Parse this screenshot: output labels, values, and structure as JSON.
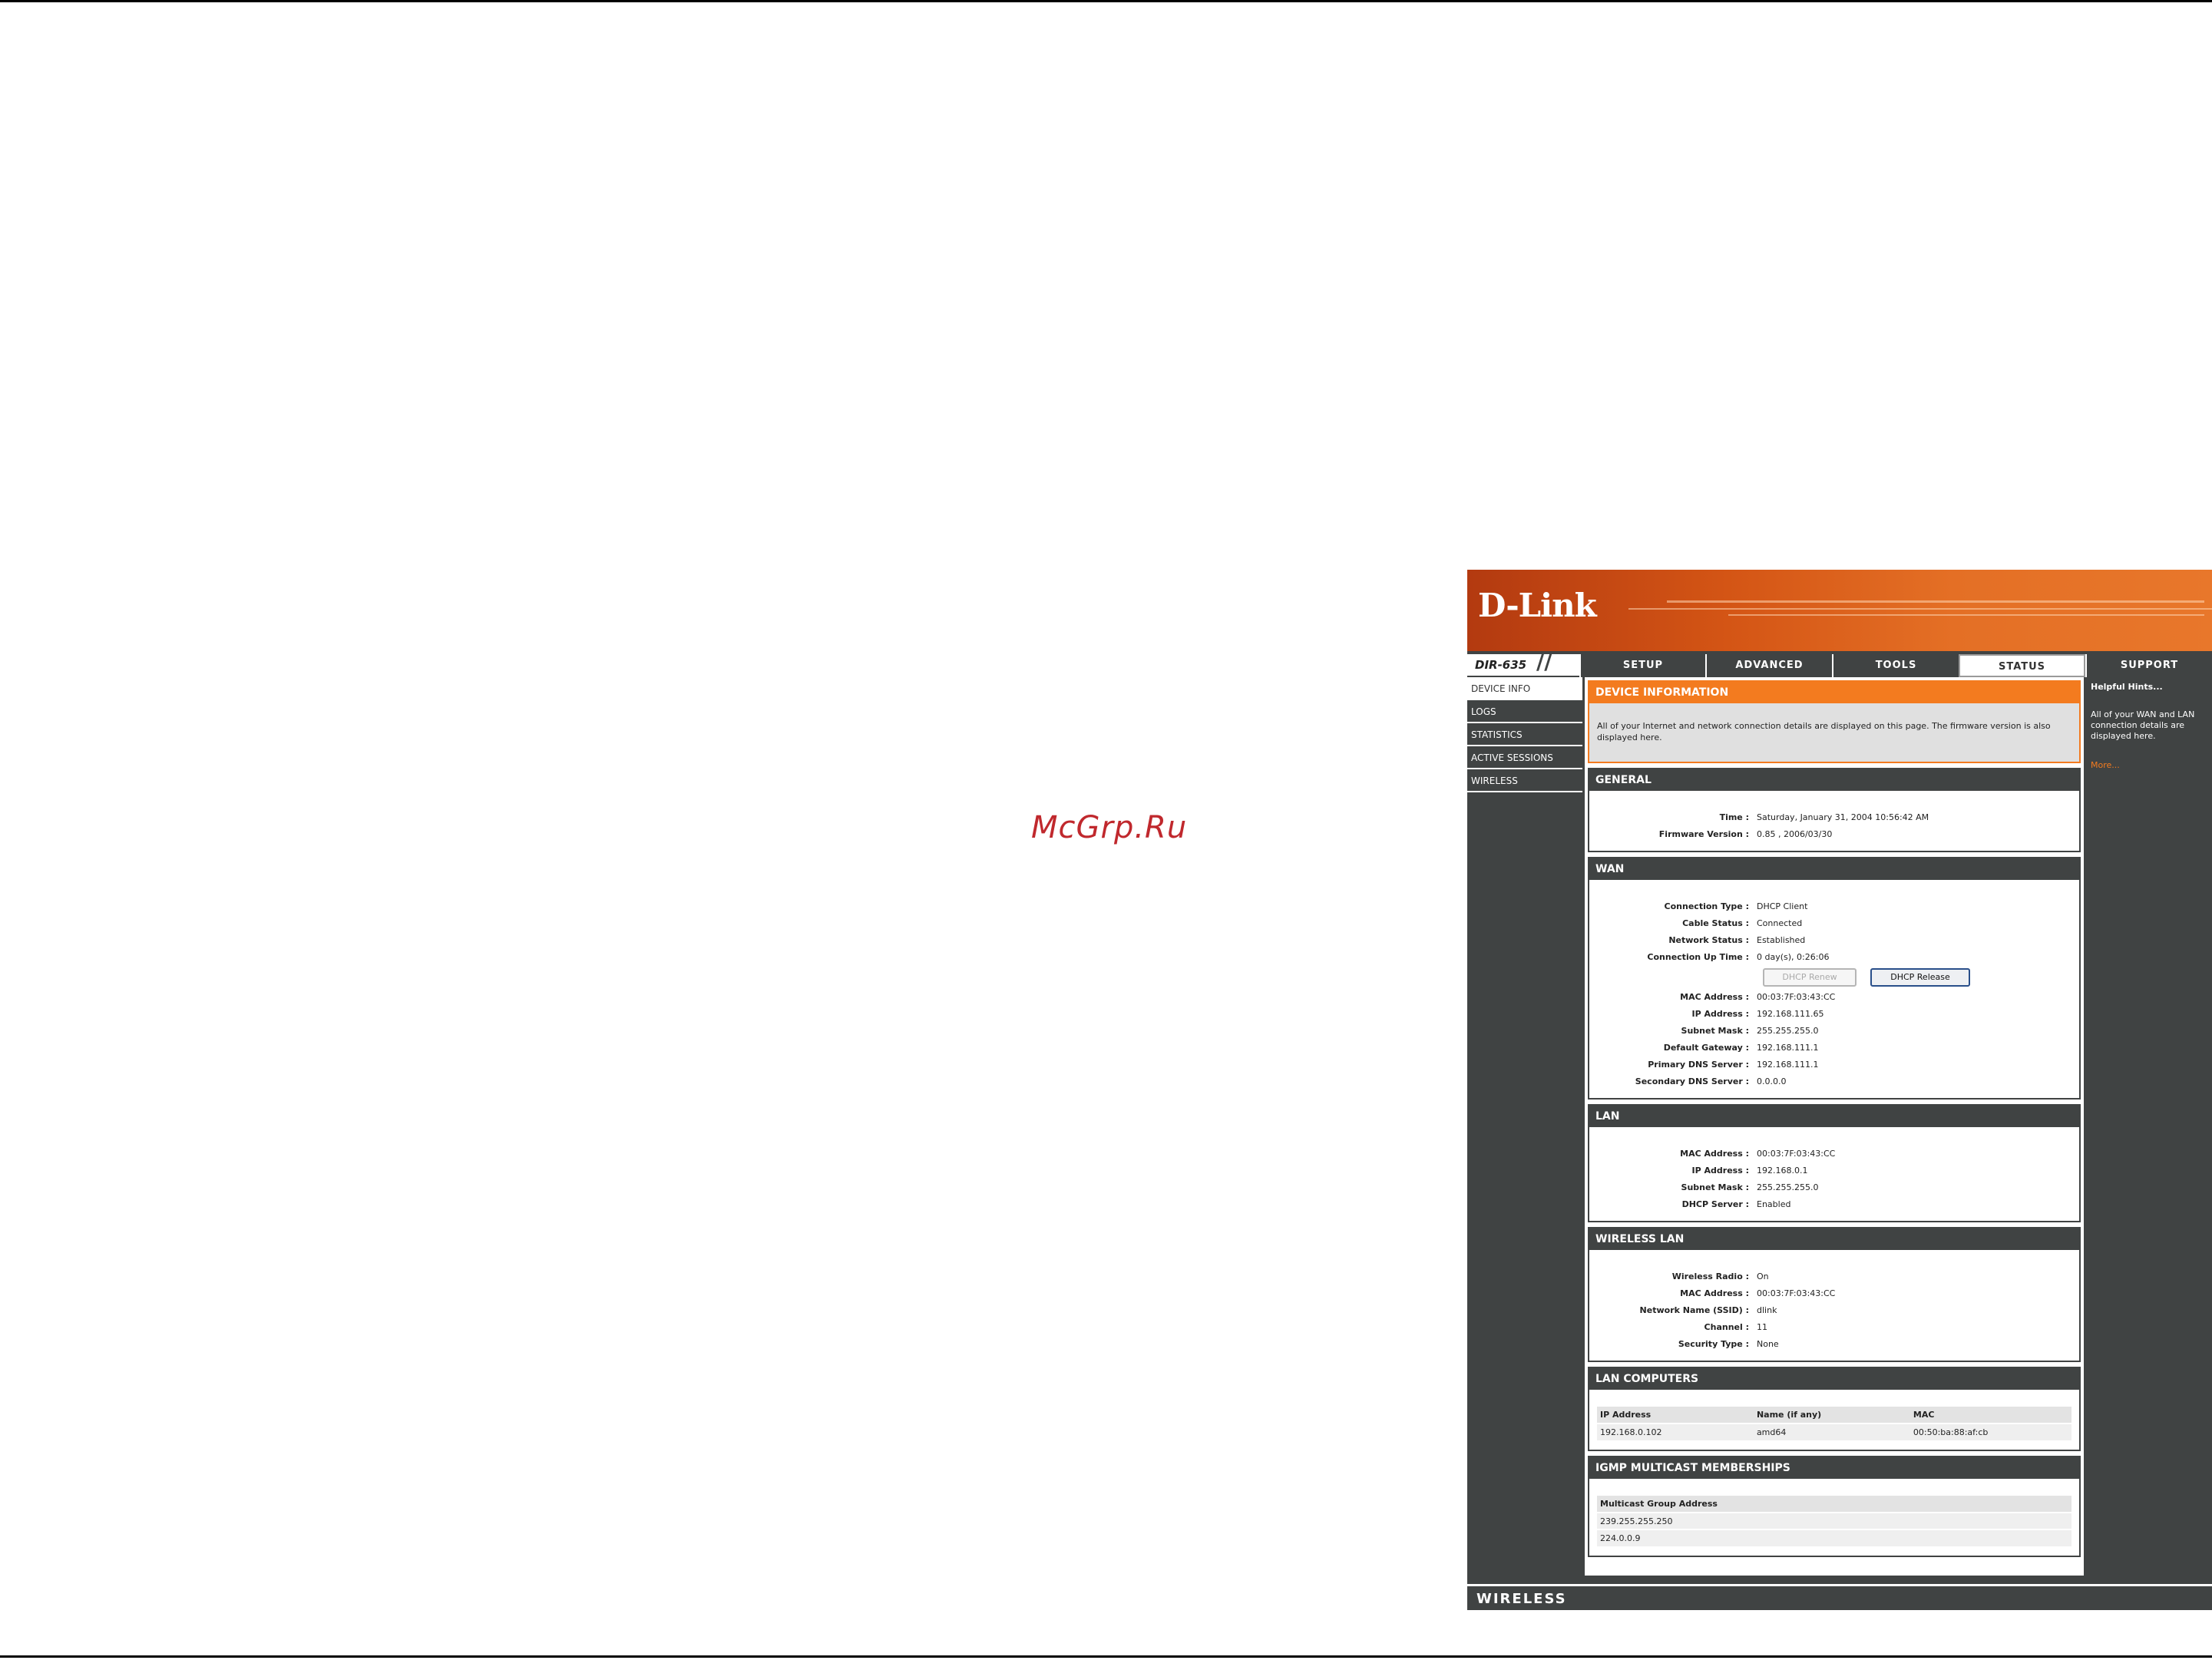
{
  "watermark": "McGrp.Ru",
  "brand": {
    "logo": "D-Link",
    "model": "DIR-635",
    "footer": "WIRELESS"
  },
  "tabs": [
    {
      "label": "SETUP"
    },
    {
      "label": "ADVANCED"
    },
    {
      "label": "TOOLS"
    },
    {
      "label": "STATUS",
      "active": true
    },
    {
      "label": "SUPPORT"
    }
  ],
  "sidebar": {
    "items": [
      {
        "label": "DEVICE INFO",
        "active": true
      },
      {
        "label": "LOGS"
      },
      {
        "label": "STATISTICS"
      },
      {
        "label": "ACTIVE SESSIONS"
      },
      {
        "label": "WIRELESS"
      }
    ]
  },
  "device_info": {
    "title": "DEVICE INFORMATION",
    "intro": "All of your Internet and network connection details are displayed on this page. The firmware version is also displayed here."
  },
  "general": {
    "title": "GENERAL",
    "time_label": "Time :",
    "time": "Saturday, January 31, 2004 10:56:42 AM",
    "firmware_label": "Firmware Version :",
    "firmware": "0.85 ,    2006/03/30"
  },
  "wan": {
    "title": "WAN",
    "connection_type_label": "Connection Type :",
    "connection_type": "DHCP Client",
    "cable_status_label": "Cable Status :",
    "cable_status": "Connected",
    "network_status_label": "Network Status :",
    "network_status": "Established",
    "uptime_label": "Connection Up Time :",
    "uptime": "0 day(s), 0:26:06",
    "renew_button": "DHCP Renew",
    "release_button": "DHCP Release",
    "mac_label": "MAC Address :",
    "mac": "00:03:7F:03:43:CC",
    "ip_label": "IP Address :",
    "ip": "192.168.111.65",
    "subnet_label": "Subnet Mask :",
    "subnet": "255.255.255.0",
    "gateway_label": "Default Gateway :",
    "gateway": "192.168.111.1",
    "dns1_label": "Primary DNS Server :",
    "dns1": "192.168.111.1",
    "dns2_label": "Secondary DNS Server :",
    "dns2": "0.0.0.0"
  },
  "lan": {
    "title": "LAN",
    "mac_label": "MAC Address :",
    "mac": "00:03:7F:03:43:CC",
    "ip_label": "IP Address :",
    "ip": "192.168.0.1",
    "subnet_label": "Subnet Mask :",
    "subnet": "255.255.255.0",
    "dhcp_label": "DHCP Server :",
    "dhcp": "Enabled"
  },
  "wireless_lan": {
    "title": "WIRELESS LAN",
    "radio_label": "Wireless Radio :",
    "radio": "On",
    "mac_label": "MAC Address :",
    "mac": "00:03:7F:03:43:CC",
    "ssid_label": "Network Name (SSID) :",
    "ssid": "dlink",
    "channel_label": "Channel :",
    "channel": "11",
    "security_label": "Security Type :",
    "security": "None"
  },
  "lan_computers": {
    "title": "LAN COMPUTERS",
    "headers": [
      "IP Address",
      "Name (if any)",
      "MAC"
    ],
    "rows": [
      [
        "192.168.0.102",
        "amd64",
        "00:50:ba:88:af:cb"
      ]
    ]
  },
  "igmp": {
    "title": "IGMP MULTICAST MEMBERSHIPS",
    "header": "Multicast Group Address",
    "rows": [
      "239.255.255.250",
      "224.0.0.9"
    ]
  },
  "hints": {
    "title": "Helpful Hints...",
    "text": "All of your WAN and LAN connection details are displayed here.",
    "more": "More..."
  }
}
